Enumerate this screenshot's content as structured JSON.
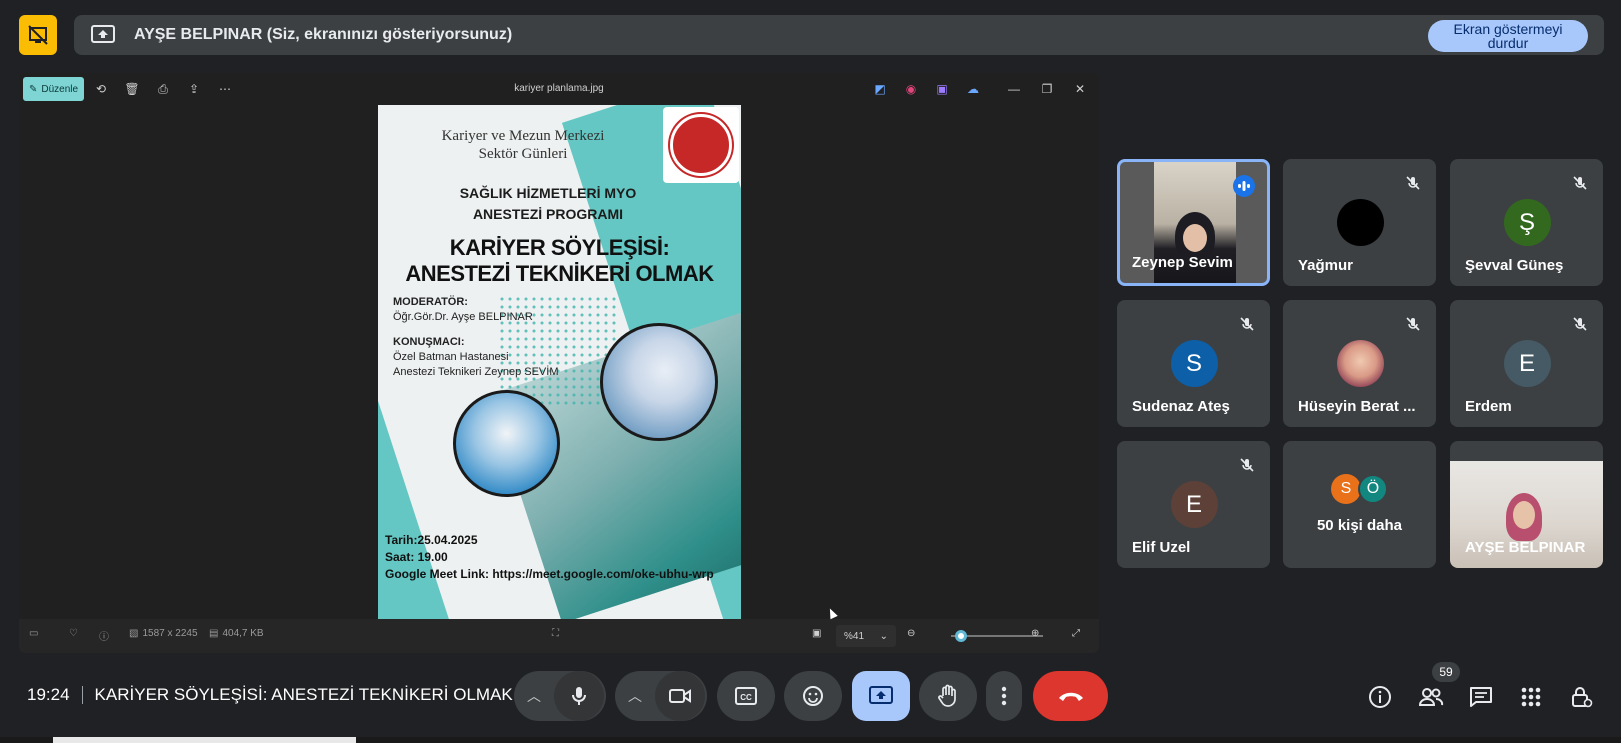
{
  "banner": {
    "presenting_text": "AYŞE BELPINAR (Siz, ekranınızı gösteriyorsunuz)",
    "stop_button": "Ekran göstermeyi durdur"
  },
  "viewer": {
    "edit_label": "Düzenle",
    "file_name": "kariyer planlama.jpg",
    "dimensions": "1587 x 2245",
    "file_size": "404,7 KB",
    "zoom": "%41"
  },
  "poster": {
    "org_line1": "Kariyer ve Mezun Merkezi",
    "org_line2": "Sektör Günleri",
    "seal_text": "Bozok",
    "dept_line1": "SAĞLIK HİZMETLERİ MYO",
    "dept_line2": "ANESTEZİ PROGRAMI",
    "title_line1": "KARİYER SÖYLEŞİSİ:",
    "title_line2": "ANESTEZİ TEKNİKERİ OLMAK",
    "moderator_label": "MODERATÖR:",
    "moderator_name": "Öğr.Gör.Dr. Ayşe BELPINAR",
    "speaker_label": "KONUŞMACI:",
    "speaker_line1": "Özel Batman Hastanesi",
    "speaker_line2": "Anestezi Teknikeri Zeynep SEVİM",
    "date": "Tarih:25.04.2025",
    "time": "Saat: 19.00",
    "link": "Google Meet Link: https://meet.google.com/oke-ubhu-wrp"
  },
  "participants": [
    {
      "name": "Zeynep Sevim",
      "initial": "",
      "color": "",
      "muted": false,
      "speaking": true
    },
    {
      "name": "Yağmur",
      "initial": "",
      "color": "#000000",
      "muted": true
    },
    {
      "name": "Şevval Güneş",
      "initial": "Ş",
      "color": "#33691e",
      "muted": true
    },
    {
      "name": "Sudenaz Ateş",
      "initial": "S",
      "color": "#0d5fa8",
      "muted": true
    },
    {
      "name": "Hüseyin Berat ...",
      "initial": "",
      "color": "",
      "muted": true
    },
    {
      "name": "Erdem",
      "initial": "E",
      "color": "#455a64",
      "muted": true
    },
    {
      "name": "Elif Uzel",
      "initial": "E",
      "color": "#5d4037",
      "muted": true
    },
    {
      "name": "50 kişi daha",
      "initials": [
        "S",
        "Ö"
      ],
      "colors": [
        "#e8711a",
        "#12877f"
      ]
    },
    {
      "name": "AYŞE BELPINAR",
      "initial": "",
      "color": "",
      "muted": false
    }
  ],
  "bottom": {
    "time": "19:24",
    "meeting_title": "KARİYER SÖYLEŞİSİ: ANESTEZİ TEKNİKERİ OLMAK",
    "participant_count": "59"
  },
  "colors": {
    "background": "#202124",
    "tile": "#3c4043",
    "accent": "#8ab4f8",
    "end_call": "#dc362e",
    "present_active": "#a8c7fa"
  }
}
